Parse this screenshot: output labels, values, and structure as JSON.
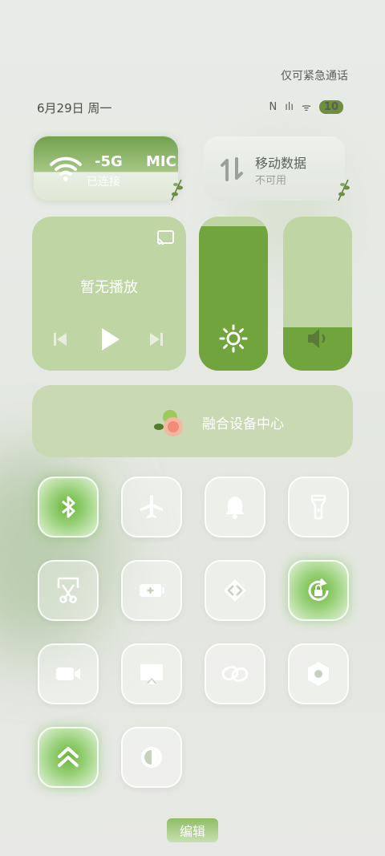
{
  "emergency_text": "仅可紧急通话",
  "date": "6月29日 周一",
  "status": {
    "nfc": "N",
    "signal": "ılı",
    "wifi": "ᯤ",
    "battery": "10"
  },
  "wifi": {
    "title": "-5G",
    "extra": "MIC",
    "subtitle": "已连接"
  },
  "mobile": {
    "title": "移动数据",
    "subtitle": "不可用"
  },
  "media": {
    "title": "暂无播放"
  },
  "brightness": {
    "level": 0.94
  },
  "volume": {
    "level": 0.28
  },
  "device_center": {
    "label": "融合设备中心"
  },
  "tiles": [
    {
      "icon": "bluetooth-icon",
      "active": true
    },
    {
      "icon": "airplane-icon",
      "active": false
    },
    {
      "icon": "bell-icon",
      "active": false
    },
    {
      "icon": "flashlight-icon",
      "active": false
    },
    {
      "icon": "screenshot-icon",
      "active": false
    },
    {
      "icon": "battery-saver-icon",
      "active": false
    },
    {
      "icon": "share-icon",
      "active": false
    },
    {
      "icon": "rotation-lock-icon",
      "active": true
    },
    {
      "icon": "video-icon",
      "active": false
    },
    {
      "icon": "screen-cast-icon",
      "active": false
    },
    {
      "icon": "link-icon",
      "active": false
    },
    {
      "icon": "settings-hex-icon",
      "active": false
    },
    {
      "icon": "performance-icon",
      "active": true
    },
    {
      "icon": "dark-mode-icon",
      "active": false
    }
  ],
  "edit_label": "编辑",
  "colors": {
    "accent": "#72a43d",
    "panel": "#bfd5a4"
  }
}
